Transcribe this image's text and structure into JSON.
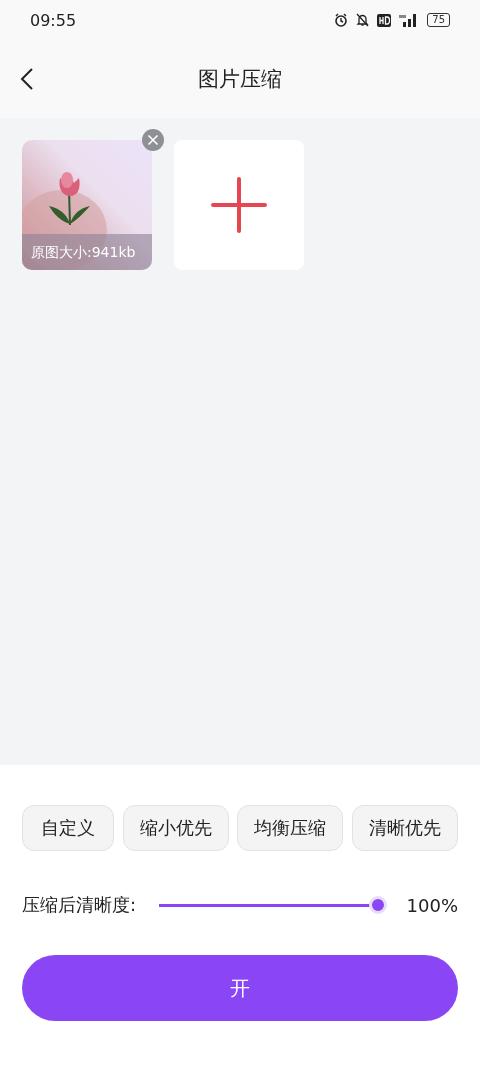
{
  "status_bar": {
    "time": "09:55",
    "battery": "75"
  },
  "header": {
    "title": "图片压缩"
  },
  "images": [
    {
      "kind": "picture",
      "caption": "原图大小:941kb"
    }
  ],
  "presets": [
    "自定义",
    "缩小优先",
    "均衡压缩",
    "清晰优先"
  ],
  "quality": {
    "label": "压缩后清晰度:",
    "level": 1,
    "reading": "100%"
  },
  "start_button": {
    "label": "开"
  }
}
